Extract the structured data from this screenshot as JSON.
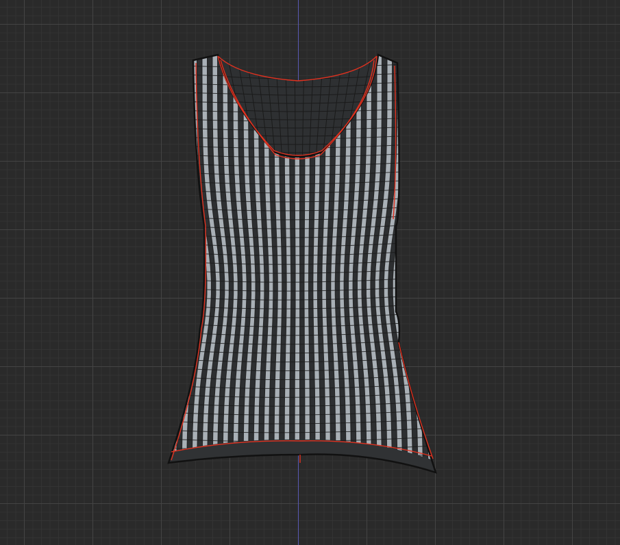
{
  "viewport": {
    "background": "#2a2a2a",
    "grid_color": "#464646",
    "axis_color": "#5a5ab4"
  },
  "mesh": {
    "object": "tank-top-garment",
    "stripe_light": "#a9b0b6",
    "stripe_dark": "#2d2f31",
    "wire_color": "#1a1a1a",
    "seam_color": "#e0311f",
    "stripe_count": 26
  }
}
